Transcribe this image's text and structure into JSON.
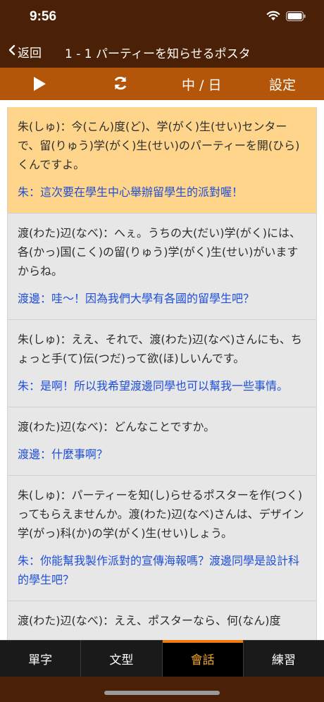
{
  "status": {
    "time": "9:56"
  },
  "nav": {
    "back_label": "返回",
    "title": "1 - 1 パーティーを知らせるポスタ"
  },
  "toolbar": {
    "lang_label": "中 / 日",
    "settings_label": "設定"
  },
  "entries": [
    {
      "jp": "朱(しゅ)：今(こん)度(ど)、学(がく)生(せい)センターで、留(りゅう)学(がく)生(せい)のパーティーを開(ひら)くんですよ。",
      "zh": "朱：這次要在學生中心舉辦留學生的派對喔！"
    },
    {
      "jp": "渡(わた)辺(なべ)：へぇ。うちの大(だい)学(がく)には、各(かっ)国(こく)の留(りゅう)学(がく)生(せい)がいますからね。",
      "zh": "渡邊：哇～！因為我們大學有各國的留學生吧？"
    },
    {
      "jp": "朱(しゅ)：ええ、それで、渡(わた)辺(なべ)さんにも、ちょっと手(て)伝(つだ)って欲(ほ)しいんです。",
      "zh": "朱：是啊！所以我希望渡邊同學也可以幫我一些事情。"
    },
    {
      "jp": "渡(わた)辺(なべ)：どんなことですか。",
      "zh": "渡邊：什麼事啊？"
    },
    {
      "jp": "朱(しゅ)：パーティーを知(し)らせるポスターを作(つく)ってもらえませんか。渡(わた)辺(なべ)さんは、デザイン学(がっ)科(か)の学(がく)生(せい)しょう。",
      "zh": "朱：你能幫我製作派對的宣傳海報嗎？渡邊同學是設計科的學生吧？"
    },
    {
      "jp": "渡(わた)辺(なべ)：ええ、ポスターなら、何(なん)度",
      "zh": ""
    }
  ],
  "tabs": [
    {
      "label": "單字"
    },
    {
      "label": "文型"
    },
    {
      "label": "會話"
    },
    {
      "label": "練習"
    }
  ],
  "colors": {
    "header": "#4a2006",
    "toolbar": "#b4560a",
    "active_entry": "#fed58a",
    "zh_text": "#1f4fd6",
    "active_tab": "#f5a623"
  }
}
